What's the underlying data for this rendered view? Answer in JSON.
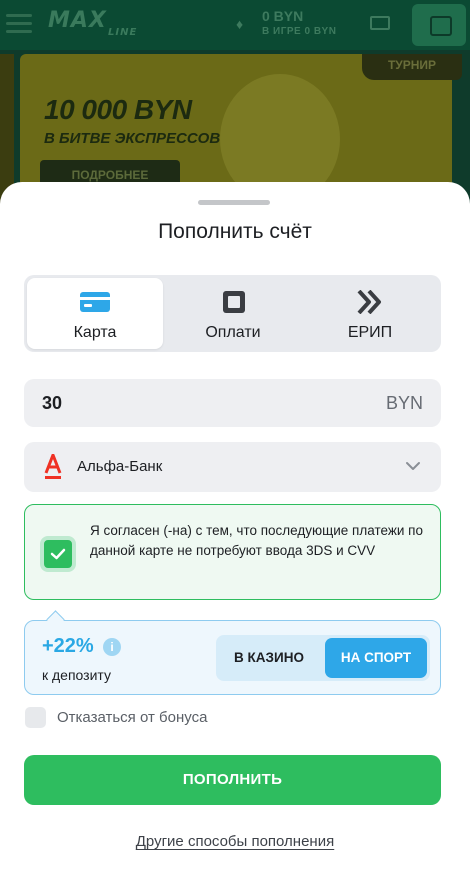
{
  "background": {
    "logo": "MAX",
    "logo_sub": "LINE",
    "balance": "0 BYN",
    "balance_sub": "В ИГРЕ 0 BYN",
    "banner_title": "10 000 BYN",
    "banner_sub": "В БИТВЕ ЭКСПРЕССОВ",
    "banner_button": "ПОДРОБНЕЕ",
    "tournament_tag": "ТУРНИР"
  },
  "sheet": {
    "title": "Пополнить счёт",
    "tabs": [
      {
        "label": "Карта",
        "icon": "card-icon",
        "active": true
      },
      {
        "label": "Оплати",
        "icon": "square-frame-icon",
        "active": false
      },
      {
        "label": "ЕРИП",
        "icon": "double-chevron-icon",
        "active": false
      }
    ],
    "amount": {
      "value": "30",
      "currency": "BYN"
    },
    "bank": {
      "name": "Альфа-Банк",
      "icon": "alfa-bank-icon"
    },
    "consent": {
      "checked": true,
      "text": "Я согласен (-на) с тем, что последующие платежи по данной карте не потребуют ввода 3DS и CVV"
    },
    "bonus": {
      "percent": "+22%",
      "subtitle": "к депозиту",
      "options": [
        "В КАЗИНО",
        "НА СПОРТ"
      ],
      "selected": "НА СПОРТ"
    },
    "decline_bonus": {
      "label": "Отказаться от бонуса",
      "checked": false
    },
    "submit_label": "ПОПОЛНИТЬ",
    "other_methods_link": "Другие способы пополнения"
  },
  "colors": {
    "accent_green": "#2ebd5f",
    "accent_blue": "#2ea7e8",
    "alfa_red": "#ef3124"
  }
}
